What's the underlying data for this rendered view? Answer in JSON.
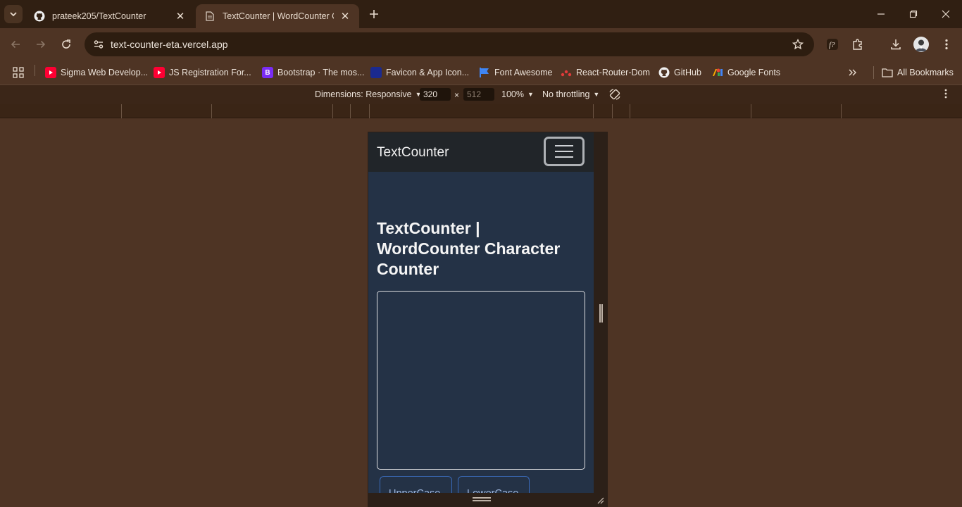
{
  "browser": {
    "tabs": [
      {
        "title": "prateek205/TextCounter",
        "favicon": "github-icon",
        "active": false
      },
      {
        "title": "TextCounter | WordCounter Cha",
        "favicon": "page-icon",
        "active": true
      }
    ],
    "url": "text-counter-eta.vercel.app",
    "bookmarks": [
      {
        "label": "Sigma Web Develop...",
        "icon": "youtube-icon"
      },
      {
        "label": "JS Registration For...",
        "icon": "youtube-icon"
      },
      {
        "label": "Bootstrap · The mos...",
        "icon": "bootstrap-icon"
      },
      {
        "label": "Favicon & App Icon...",
        "icon": "favicon-icon"
      },
      {
        "label": "Font Awesome",
        "icon": "flag-icon"
      },
      {
        "label": "React-Router-Dom",
        "icon": "react-router-icon"
      },
      {
        "label": "GitHub",
        "icon": "github-icon"
      },
      {
        "label": "Google Fonts",
        "icon": "google-fonts-icon"
      }
    ],
    "all_bookmarks_label": "All Bookmarks"
  },
  "devtools": {
    "dimensions_label": "Dimensions: Responsive",
    "width": "320",
    "height": "512",
    "zoom": "100%",
    "throttling": "No throttling"
  },
  "page": {
    "brand": "TextCounter",
    "heading": "TextCounter | WordCounter Character Counter",
    "textarea_value": "",
    "buttons": {
      "uppercase": "UpperCase",
      "lowercase": "LowerCase"
    }
  },
  "colors": {
    "browser_frame": "#4e3424",
    "navbar": "#212529",
    "page_bg": "#243246",
    "button_border": "#3a6ab8"
  }
}
